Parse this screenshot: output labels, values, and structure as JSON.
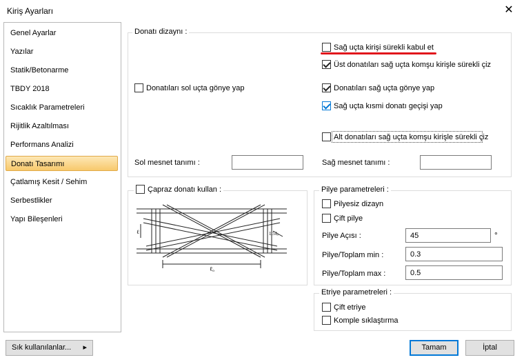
{
  "window": {
    "title": "Kiriş Ayarları",
    "close_glyph": "✕"
  },
  "sidebar": {
    "items": [
      {
        "label": "Genel Ayarlar"
      },
      {
        "label": "Yazılar"
      },
      {
        "label": "Statik/Betonarme"
      },
      {
        "label": "TBDY 2018"
      },
      {
        "label": "Sıcaklık Parametreleri"
      },
      {
        "label": "Rijitlik Azaltılması"
      },
      {
        "label": "Performans Analizi"
      },
      {
        "label": "Donatı Tasarımı",
        "selected": true
      },
      {
        "label": "Çatlamış Kesit / Sehim"
      },
      {
        "label": "Serbestlikler"
      },
      {
        "label": "Yapı Bileşenleri"
      }
    ]
  },
  "donati": {
    "group_label": "Donatı dizaynı :",
    "sol_gonye": {
      "label": "Donatıları sol uçta gönye yap",
      "checked": false
    },
    "sag_surekli": {
      "label": "Sağ uçta kirişi sürekli kabul et",
      "checked": false
    },
    "ust_surekli": {
      "label": "Üst donatıları sağ uçta komşu kirişle sürekli çiz",
      "checked": true
    },
    "sag_gonye": {
      "label": "Donatıları sağ uçta gönye yap",
      "checked": true
    },
    "kismi": {
      "label": "Sağ uçta kısmi donatı geçişi yap",
      "checked": true
    },
    "alt_surekli": {
      "label": "Alt donatıları sağ uçta komşu kirişle sürekli çiz",
      "checked": false
    },
    "sol_mesnet_label": "Sol mesnet tanımı :",
    "sol_mesnet_value": "",
    "sag_mesnet_label": "Sağ mesnet tanımı :",
    "sag_mesnet_value": ""
  },
  "capraz": {
    "label": "Çapraz donatı kullan :",
    "checked": false,
    "diagram_labels": {
      "l": "ℓ",
      "lo": "ℓₒ",
      "dim": "1.5ℓₒ"
    }
  },
  "pilye": {
    "group_label": "Pilye parametreleri :",
    "pilyesiz": {
      "label": "Pilyesiz dizayn",
      "checked": false
    },
    "cift": {
      "label": "Çift pilye",
      "checked": false
    },
    "aci_label": "Pilye Açısı :",
    "aci_value": "45",
    "aci_unit": "°",
    "min_label": "Pilye/Toplam min :",
    "min_value": "0.3",
    "max_label": "Pilye/Toplam max :",
    "max_value": "0.5"
  },
  "etriye": {
    "group_label": "Etriye parametreleri :",
    "cift": {
      "label": "Çift etriye",
      "checked": false
    },
    "komple": {
      "label": "Komple sıklaştırma",
      "checked": false
    }
  },
  "footer": {
    "frequent_label": "Sık kullanılanlar...",
    "frequent_arrow": "▸",
    "ok_label": "Tamam",
    "cancel_label": "İptal"
  }
}
